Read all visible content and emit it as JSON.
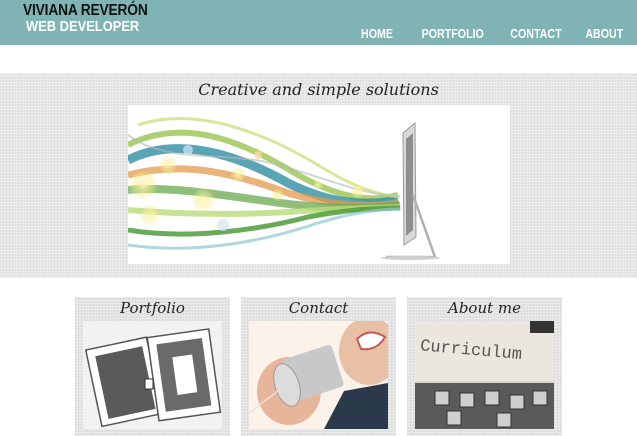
{
  "header": {
    "brand_name": "VIVIANA REVERÓN",
    "brand_role": "WEB DEVELOPER",
    "nav": [
      "HOME",
      "PORTFOLIO",
      "CONTACT",
      "ABOUT"
    ],
    "background_color": "#7fb3b4"
  },
  "hero": {
    "title": "Creative and simple solutions",
    "image_icon": "monitor-with-colorful-ribbons"
  },
  "cards": [
    {
      "title": "Portfolio",
      "image_icon": "folders-image"
    },
    {
      "title": "Contact",
      "image_icon": "tin-can-phone-image"
    },
    {
      "title": "About me",
      "image_icon": "typewriter-curriculum-image"
    }
  ],
  "card_image_text": "Curriculum"
}
